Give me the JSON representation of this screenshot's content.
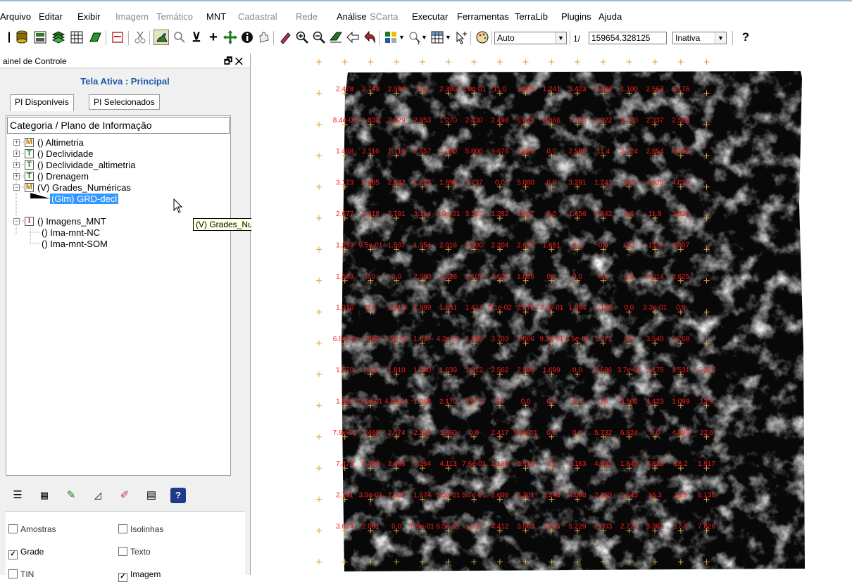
{
  "menubar": {
    "items": [
      {
        "label": "Arquivo",
        "enabled": true
      },
      {
        "label": "Editar",
        "enabled": true
      },
      {
        "label": "Exibir",
        "enabled": true
      },
      {
        "label": "Imagem",
        "enabled": false
      },
      {
        "label": "Temático",
        "enabled": false
      },
      {
        "label": "MNT",
        "enabled": true
      },
      {
        "label": "Cadastral",
        "enabled": false
      },
      {
        "label": "Rede",
        "enabled": false
      },
      {
        "label": "Análise",
        "enabled": true
      },
      {
        "label": "SCarta",
        "enabled": false
      },
      {
        "label": "Executar",
        "enabled": true
      },
      {
        "label": "Ferramentas",
        "enabled": true
      },
      {
        "label": "TerraLib",
        "enabled": true
      },
      {
        "label": "Plugins",
        "enabled": true
      },
      {
        "label": "Ajuda",
        "enabled": true
      }
    ]
  },
  "toolbar": {
    "zoom_mode": "Auto",
    "scale_prefix": "1/",
    "scale_value": "159654.328125",
    "status": "Inativa"
  },
  "panel": {
    "title": "ainel de Controle",
    "float_control": "🗗 ✕",
    "active_view": "Tela Ativa : Principal",
    "tabs": [
      "PI Disponíveis",
      "PI Selecionados"
    ],
    "tree_header": "Categoria / Plano de Informação",
    "tree": [
      {
        "icon": "M",
        "label": "() Altimetria"
      },
      {
        "icon": "T",
        "label": "() Declividade"
      },
      {
        "icon": "T",
        "label": "() Declividade_altimetria"
      },
      {
        "icon": "T",
        "label": "() Drenagem"
      },
      {
        "icon": "M",
        "label": "(V) Grades_Numéricas"
      },
      {
        "icon": "",
        "label": "(Glm) GRD-decl"
      },
      {
        "icon": "I",
        "label": "() Imagens_MNT"
      },
      {
        "icon": "",
        "label": "() Ima-mnt-NC"
      },
      {
        "icon": "",
        "label": "() Ima-mnt-SOM"
      }
    ],
    "tooltip": "(V) Grades_Numéricas",
    "representations": [
      {
        "label": "Amostras",
        "checked": false
      },
      {
        "label": "Isolinhas",
        "checked": false
      },
      {
        "label": "Grade",
        "checked": true
      },
      {
        "label": "Texto",
        "checked": false
      },
      {
        "label": "TIN",
        "checked": false
      },
      {
        "label": "Imagem",
        "checked": true
      }
    ]
  },
  "grid_labels": [
    [
      "2.478",
      "2.749",
      "2.994",
      "0.0",
      "2.399",
      "3.0e-01",
      "11.0",
      "5.889",
      "1.241",
      "3.423",
      "4.289",
      "1.100",
      "2.563",
      "6.176"
    ],
    [
      "8.4e-01",
      "1.830",
      "2.029",
      "2.953",
      "1.270",
      "2.430",
      "2.498",
      "6.615",
      "8.866",
      "7.763",
      "2.222",
      "3.470",
      "2.337",
      "2.506"
    ],
    [
      "1.468",
      "2.116",
      "1.716",
      "1.657",
      "1.050",
      "5.806",
      "9.678",
      "1.882",
      "0.0",
      "2.585",
      "11.4",
      "2.024",
      "2.854",
      "6.055"
    ],
    [
      "3.123",
      "2.885",
      "2.842",
      "1.815",
      "1.898",
      "1.737",
      "0.0",
      "5.080",
      "0.0",
      "3.291",
      "1.241",
      "14.5",
      "4.328",
      "4.019"
    ],
    [
      "2.677",
      "2.418",
      "2.791",
      "3.114",
      "8.0e-01",
      "3.165",
      "1.282",
      "2.847",
      "0.0",
      "1.456",
      "2.842",
      "0.0",
      "11.9",
      "3.626"
    ],
    [
      "1.263",
      "9.5e-01",
      "1.507",
      "1.954",
      "2.016",
      "2.300",
      "2.204",
      "2.877",
      "1.651",
      "0.0",
      "0.0",
      "0.0",
      "13.9",
      "2.807"
    ],
    [
      "1.563",
      "0.0",
      "0.0",
      "2.080",
      "1.228",
      "1.107",
      "3.623",
      "1.826",
      "0.0",
      "0.0",
      "0.0",
      "0.0",
      "9.014",
      "2.625"
    ],
    [
      "1.310",
      "0.0",
      "1.513",
      "1.889",
      "1.551",
      "1.417",
      "8.1e-02",
      "2.673",
      "2.2e-01",
      "1.864",
      "1.138",
      "0.0",
      "3.3e-01",
      "0.0"
    ],
    [
      "6.8e-01",
      "1.880",
      "1.9e-01",
      "1.837",
      "4.2e-01",
      "1.580",
      "3.703",
      "1.006",
      "9.2e-01",
      "6.5e-01",
      "1.371",
      "0.0",
      "3.540",
      "2.768"
    ],
    [
      "1.579",
      "1.111",
      "1.810",
      "1.290",
      "1.639",
      "1.912",
      "2.562",
      "2.399",
      "1.699",
      "0.0",
      "2.586",
      "3.7e-01",
      "3.175",
      "1.531",
      "6.297"
    ],
    [
      "1.919",
      "3.1e-01",
      "4.4e-01",
      "1.868",
      "2.170",
      "2.073",
      "0.0",
      "0.0",
      "0.0",
      "0.0",
      "0.0",
      "5.502",
      "4.423",
      "1.099",
      "13.9"
    ],
    [
      "7.9e-01",
      "2.463",
      "2.074",
      "2.204",
      "1.860",
      "0.0",
      "2.417",
      "8.9e-01",
      "0.0",
      "0.0",
      "5.732",
      "6.824",
      "0.0",
      "4.389",
      "22.6"
    ],
    [
      "7.474",
      "6.463",
      "3.405",
      "4.264",
      "4.113",
      "7.6e-01",
      "1.185",
      "5.916",
      "0.0",
      "2.163",
      "4.993",
      "1.840",
      "3.832",
      "18.2",
      "1.917"
    ],
    [
      "2.781",
      "3.9e-01",
      "2.003",
      "1.674",
      "5.3e-01",
      "5.7e-01",
      "2.698",
      "3.301",
      "3.243",
      "4.008",
      "2.169",
      "1.245",
      "16.3",
      "16.9",
      "8.130"
    ],
    [
      "3.674",
      "2.001",
      "0.0",
      "6.9e-01",
      "6.5e-01",
      "1.812",
      "4.412",
      "3.503",
      "7.025",
      "5.229",
      "2.003",
      "2.727",
      "9.381",
      "17.9",
      "7.826"
    ]
  ],
  "colors": {
    "label_color": "#ff1a1a",
    "raster_bg": "#080808",
    "cross_color": "#d9a24a",
    "selection": "#3399ff",
    "accent_title": "#1f5aa8"
  }
}
